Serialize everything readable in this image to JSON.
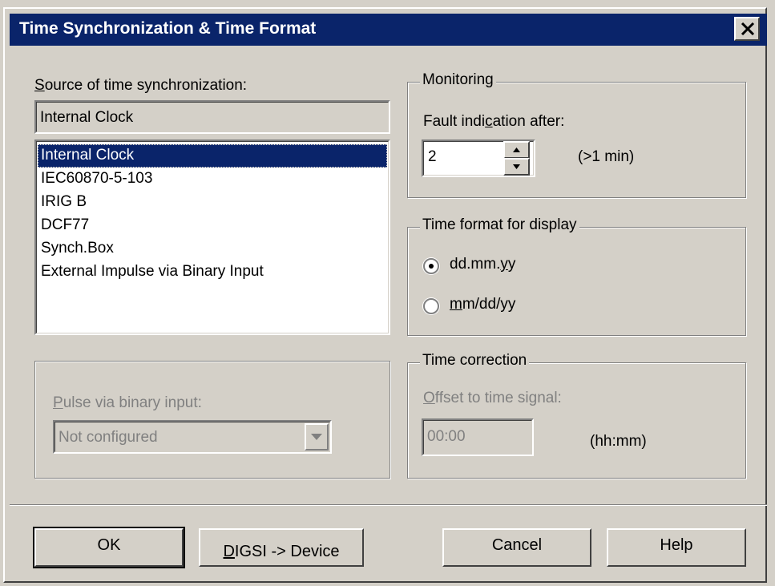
{
  "window": {
    "title": "Time Synchronization & Time Format",
    "close_label": "×"
  },
  "source": {
    "label_u": "S",
    "label_rest": "ource of time synchronization:",
    "current_value": "Internal Clock",
    "options": [
      "Internal Clock",
      "IEC60870-5-103",
      "IRIG B",
      "DCF77",
      "Synch.Box",
      "External Impulse via Binary Input"
    ],
    "selected_index": 0
  },
  "pulse": {
    "label_u": "P",
    "label_rest": "ulse via binary input:",
    "value": "Not configured"
  },
  "monitoring": {
    "title": "Monitoring",
    "label_pre": "Fault indi",
    "label_u": "c",
    "label_post": "ation after:",
    "value": "2",
    "unit": "(>1 min)"
  },
  "time_format": {
    "title": "Time format for display",
    "options": [
      {
        "pre": "dd.mm.",
        "u": "y",
        "post": "y",
        "checked": true
      },
      {
        "pre": "",
        "u": "m",
        "post": "m/dd/yy",
        "checked": false
      }
    ]
  },
  "time_correction": {
    "title": "Time correction",
    "label_u": "O",
    "label_rest": "ffset to time signal:",
    "value": "00:00",
    "unit": "(hh:mm)"
  },
  "buttons": {
    "ok": "OK",
    "digsi_u": "D",
    "digsi_rest": "IGSI -> Device",
    "cancel": "Cancel",
    "help": "Help"
  }
}
